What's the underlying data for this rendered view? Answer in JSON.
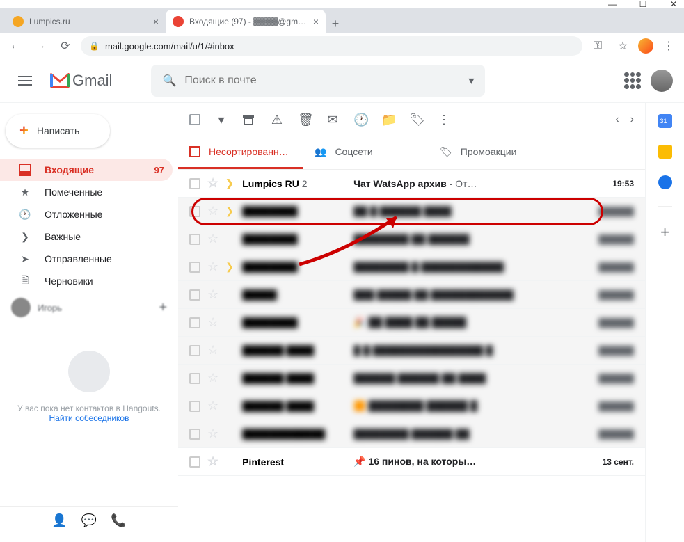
{
  "window": {
    "minimize": "—",
    "maximize": "☐",
    "close": "✕"
  },
  "browser": {
    "tabs": [
      {
        "title": "Lumpics.ru",
        "favicon": "#f5a623"
      },
      {
        "title": "Входящие (97) - ▓▓▓▓@gmai…",
        "favicon": "#ea4335"
      }
    ],
    "url": "mail.google.com/mail/u/1/#inbox"
  },
  "header": {
    "logo": "Gmail",
    "search_placeholder": "Поиск в почте"
  },
  "sidebar": {
    "compose": "Написать",
    "items": [
      {
        "label": "Входящие",
        "count": "97",
        "icon": "inbox"
      },
      {
        "label": "Помеченные",
        "icon": "star"
      },
      {
        "label": "Отложенные",
        "icon": "clock"
      },
      {
        "label": "Важные",
        "icon": "important"
      },
      {
        "label": "Отправленные",
        "icon": "send"
      },
      {
        "label": "Черновики",
        "icon": "draft"
      }
    ],
    "user": "Игорь",
    "hangouts_empty": "У вас пока нет контактов в Hangouts.",
    "hangouts_link": "Найти собеседников"
  },
  "toolbar": {},
  "tabs": [
    {
      "label": "Несортированн…",
      "icon": "inbox"
    },
    {
      "label": "Соцсети",
      "icon": "people"
    },
    {
      "label": "Промоакции",
      "icon": "tag"
    }
  ],
  "mail": [
    {
      "sender": "Lumpics RU",
      "sender_count": "2",
      "subject": "Чат WatsApp архив",
      "snippet": " - От…",
      "date": "19:53",
      "unread": true,
      "important": true
    },
    {
      "sender": "████████",
      "subject": "██ █ ██████ ████",
      "date": "██████",
      "unread": false,
      "important": true
    },
    {
      "sender": "████████",
      "subject": "████████ ██ ██████",
      "date": "██████",
      "unread": false,
      "important": false
    },
    {
      "sender": "████████",
      "subject": "████████ █ ████████████",
      "date": "██████",
      "unread": false,
      "important": true
    },
    {
      "sender": "█████",
      "subject": "███ █████ ██ ████████████",
      "date": "██████",
      "unread": false,
      "important": false
    },
    {
      "sender": "████████",
      "subject": "🎉 ██ ████ ██ █████",
      "date": "██████",
      "unread": false,
      "important": false
    },
    {
      "sender": "██████ ████",
      "subject": "█ █ ████████████████ █",
      "date": "██████",
      "unread": false,
      "important": false
    },
    {
      "sender": "██████ ████",
      "subject": "██████ ██████ ██ ████",
      "date": "██████",
      "unread": false,
      "important": false
    },
    {
      "sender": "██████ ████",
      "subject": "🟧 ████████ ██████ █",
      "date": "██████",
      "unread": false,
      "important": false
    },
    {
      "sender": "████████████",
      "subject": "████████ ██████ ██",
      "date": "██████",
      "unread": false,
      "important": false
    },
    {
      "sender": "Pinterest",
      "subject": "📌 16 пинов, на которы…",
      "date": "13 сент.",
      "unread": true,
      "important": false
    }
  ]
}
